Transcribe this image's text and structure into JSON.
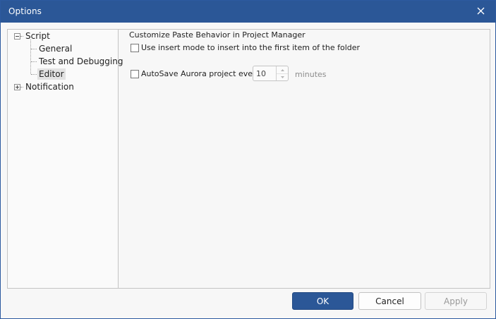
{
  "window": {
    "title": "Options"
  },
  "tree": {
    "nodes": [
      {
        "label": "Script",
        "expanded": true
      },
      {
        "label": "General"
      },
      {
        "label": "Test and Debugging"
      },
      {
        "label": "Editor",
        "selected": true
      },
      {
        "label": "Notification",
        "expanded": false
      }
    ]
  },
  "editor": {
    "section_title": "Customize Paste Behavior in Project Manager",
    "insert_mode_label": "Use insert mode to insert into the first item of the folder",
    "insert_mode_checked": false,
    "autosave_label": "AutoSave Aurora project every",
    "autosave_checked": false,
    "autosave_value": "10",
    "minutes_label": "minutes"
  },
  "buttons": {
    "ok": "OK",
    "cancel": "Cancel",
    "apply": "Apply"
  },
  "colors": {
    "titlebar": "#2b5797",
    "primary_button": "#2b5797",
    "selected_item": "#e2e2e2",
    "disabled_text": "#9a9a9a"
  },
  "icons": [
    "close-icon",
    "tree-expander-minus-icon",
    "tree-expander-plus-icon",
    "spin-up-icon",
    "spin-down-icon"
  ]
}
